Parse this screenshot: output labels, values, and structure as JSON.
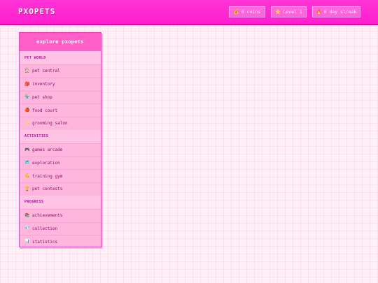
{
  "header": {
    "brand": "PXOPETS",
    "stats": [
      {
        "icon": "coin-icon",
        "glyph": "💰",
        "label": "0 coins"
      },
      {
        "icon": "star-icon",
        "glyph": "⭐",
        "label": "Level 1"
      },
      {
        "icon": "fire-icon",
        "glyph": "🔥",
        "label": "0 day streak"
      }
    ]
  },
  "sidebar": {
    "title": "explore pxopets",
    "sections": [
      {
        "label": "PET WORLD",
        "items": [
          {
            "icon": "house-icon",
            "glyph": "🏠",
            "label": "pet central"
          },
          {
            "icon": "backpack-icon",
            "glyph": "🎒",
            "label": "inventory"
          },
          {
            "icon": "shop-icon",
            "glyph": "🏪",
            "label": "pet shop"
          },
          {
            "icon": "apple-icon",
            "glyph": "🍎",
            "label": "food court"
          },
          {
            "icon": "sparkle-icon",
            "glyph": "✨",
            "label": "grooming salon"
          }
        ]
      },
      {
        "label": "ACTIVITIES",
        "items": [
          {
            "icon": "gamepad-icon",
            "glyph": "🎮",
            "label": "games arcade"
          },
          {
            "icon": "map-icon",
            "glyph": "🗺️",
            "label": "exploration"
          },
          {
            "icon": "flexed-arm-icon",
            "glyph": "💪",
            "label": "training gym"
          },
          {
            "icon": "trophy-icon",
            "glyph": "🏆",
            "label": "pet contests"
          }
        ]
      },
      {
        "label": "PROGRESS",
        "items": [
          {
            "icon": "books-icon",
            "glyph": "📚",
            "label": "achievements"
          },
          {
            "icon": "gem-icon",
            "glyph": "💎",
            "label": "collection"
          },
          {
            "icon": "chart-icon",
            "glyph": "📊",
            "label": "statistics"
          }
        ]
      }
    ]
  },
  "colors": {
    "header_bg": "#ff1fcf",
    "page_bg": "#fff0f7",
    "panel_bg": "#ffb6dc",
    "panel_header": "#ff5fc6",
    "section_text": "#c000a8",
    "item_text": "#8a0c6a"
  }
}
